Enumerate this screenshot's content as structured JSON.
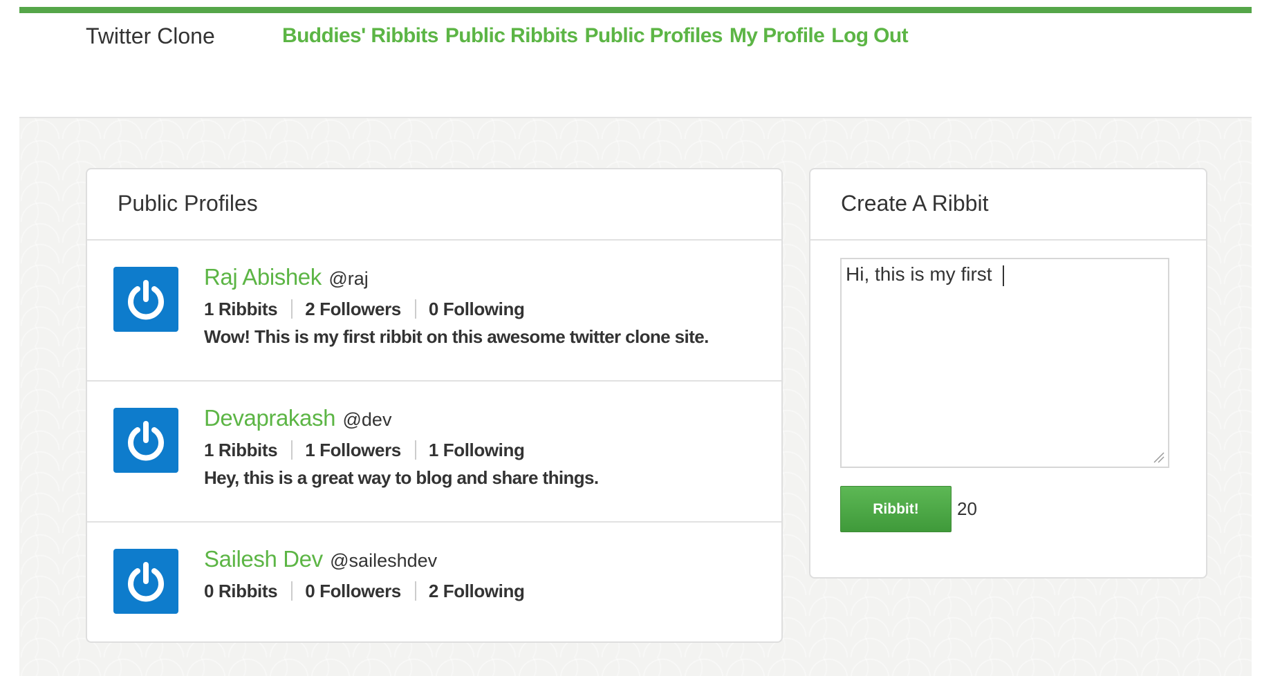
{
  "header": {
    "brand": "Twitter Clone",
    "nav": [
      {
        "label": "Buddies' Ribbits"
      },
      {
        "label": "Public Ribbits"
      },
      {
        "label": "Public Profiles"
      },
      {
        "label": "My Profile"
      },
      {
        "label": "Log Out"
      }
    ]
  },
  "profiles_panel": {
    "title": "Public Profiles",
    "profiles": [
      {
        "name": "Raj Abishek",
        "handle": "@raj",
        "ribbits": "1 Ribbits",
        "followers": "2 Followers",
        "following": "0 Following",
        "latest": "Wow! This is my first ribbit on this awesome twitter clone site.",
        "avatar_icon": "power-icon"
      },
      {
        "name": "Devaprakash",
        "handle": "@dev",
        "ribbits": "1 Ribbits",
        "followers": "1 Followers",
        "following": "1 Following",
        "latest": "Hey, this is a great way to blog and share things.",
        "avatar_icon": "power-icon"
      },
      {
        "name": "Sailesh Dev",
        "handle": "@saileshdev",
        "ribbits": "0 Ribbits",
        "followers": "0 Followers",
        "following": "2 Following",
        "latest": "",
        "avatar_icon": "power-icon"
      }
    ]
  },
  "create_panel": {
    "title": "Create A Ribbit",
    "textarea_value": "Hi, this is my first ",
    "button_label": "Ribbit!",
    "char_count": "20"
  },
  "colors": {
    "accent_green": "#5cb545",
    "avatar_blue": "#0e7ccc",
    "top_bar": "#55a649"
  }
}
